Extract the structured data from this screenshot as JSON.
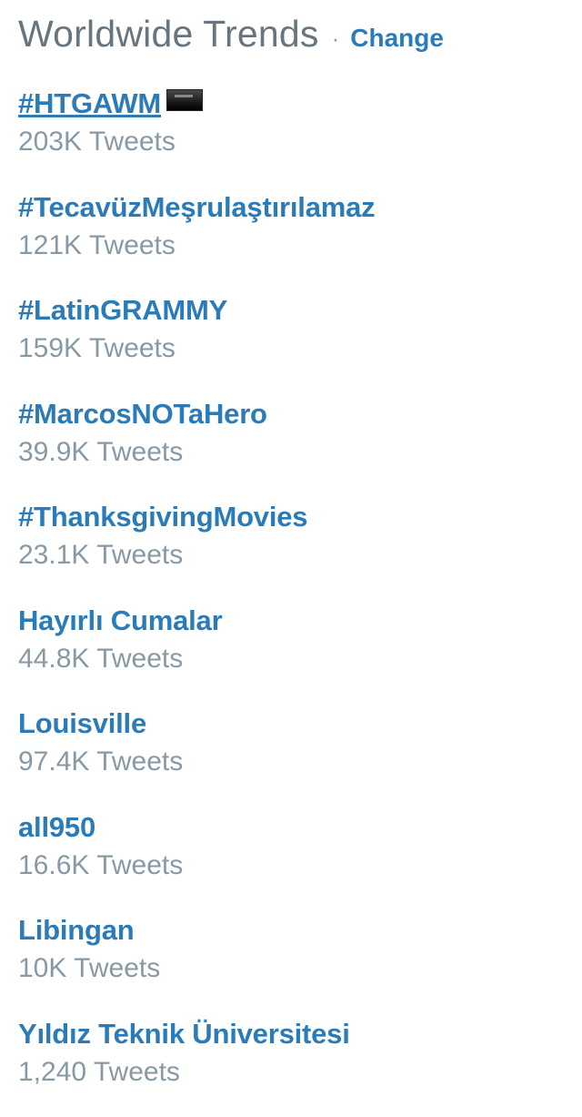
{
  "header": {
    "title": "Worldwide Trends",
    "separator": "·",
    "change_label": "Change"
  },
  "colors": {
    "link": "#2b7bb9",
    "muted": "#8899a6",
    "title": "#66757f"
  },
  "trends": [
    {
      "name": "#HTGAWM",
      "count": "203K Tweets",
      "has_image": true
    },
    {
      "name": "#TecavüzMeşrulaştırılamaz",
      "count": "121K Tweets"
    },
    {
      "name": "#LatinGRAMMY",
      "count": "159K Tweets"
    },
    {
      "name": "#MarcosNOTaHero",
      "count": "39.9K Tweets"
    },
    {
      "name": "#ThanksgivingMovies",
      "count": "23.1K Tweets"
    },
    {
      "name": "Hayırlı Cumalar",
      "count": "44.8K Tweets"
    },
    {
      "name": "Louisville",
      "count": "97.4K Tweets"
    },
    {
      "name": "all950",
      "count": "16.6K Tweets"
    },
    {
      "name": "Libingan",
      "count": "10K Tweets"
    },
    {
      "name": "Yıldız Teknik Üniversitesi",
      "count": "1,240 Tweets"
    }
  ]
}
